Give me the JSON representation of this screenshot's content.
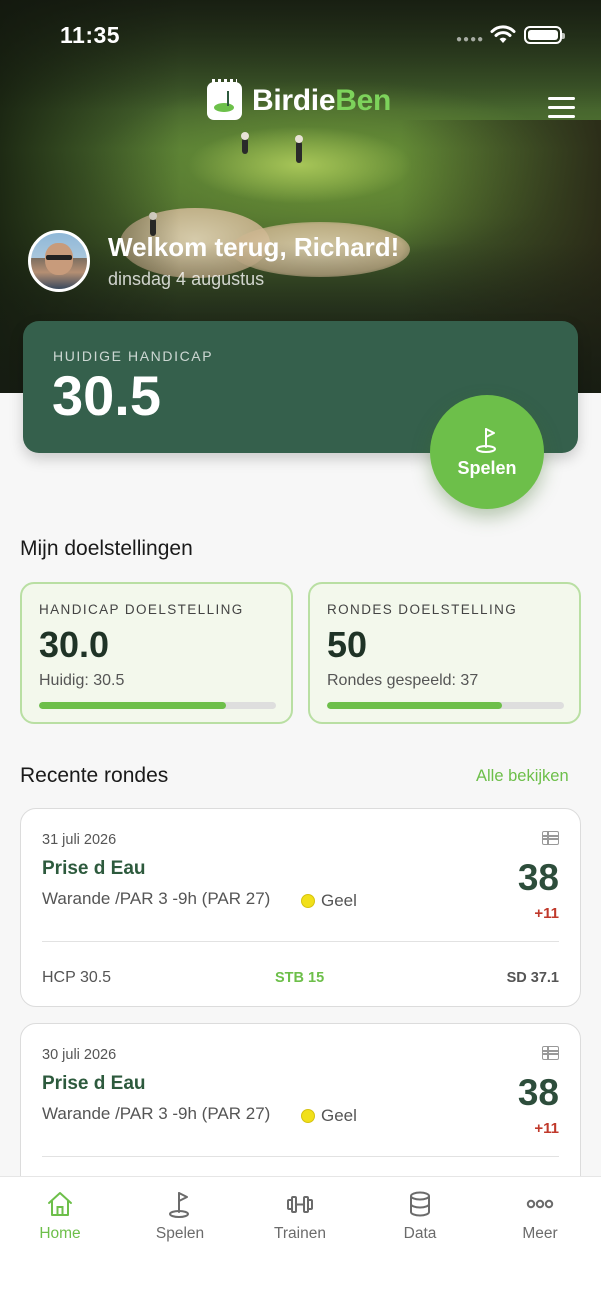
{
  "status_bar": {
    "time": "11:35"
  },
  "header": {
    "brand_part1": "Birdie",
    "brand_part2": "Ben",
    "welcome": "Welkom terug, Richard!",
    "date": "dinsdag 4 augustus"
  },
  "handicap": {
    "label": "HUIDIGE HANDICAP",
    "value": "30.5",
    "play_label": "Spelen"
  },
  "goals": {
    "title": "Mijn doelstellingen",
    "items": [
      {
        "label": "HANDICAP DOELSTELLING",
        "value": "30.0",
        "sub": "Huidig: 30.5",
        "progress": 0.79
      },
      {
        "label": "RONDES DOELSTELLING",
        "value": "50",
        "sub": "Rondes gespeeld: 37",
        "progress": 0.74
      }
    ]
  },
  "rounds": {
    "title": "Recente rondes",
    "see_all": "Alle bekijken",
    "items": [
      {
        "date": "31 juli 2026",
        "course": "Prise d Eau",
        "loop": "Warande /PAR 3 -9h (PAR 27)",
        "tee": "Geel",
        "tee_color": "#f1e01a",
        "score": "38",
        "diff": "+11",
        "hcp": "HCP 30.5",
        "stb": "STB 15",
        "sd": "SD 37.1"
      },
      {
        "date": "30 juli 2026",
        "course": "Prise d Eau",
        "loop": "Warande /PAR 3 -9h (PAR 27)",
        "tee": "Geel",
        "tee_color": "#f1e01a",
        "score": "38",
        "diff": "+11"
      }
    ]
  },
  "tabbar": {
    "items": [
      {
        "label": "Home",
        "icon": "home-icon",
        "active": true
      },
      {
        "label": "Spelen",
        "icon": "golf-flag-icon",
        "active": false
      },
      {
        "label": "Trainen",
        "icon": "dumbbell-icon",
        "active": false
      },
      {
        "label": "Data",
        "icon": "database-icon",
        "active": false
      },
      {
        "label": "Meer",
        "icon": "more-icon",
        "active": false
      }
    ]
  },
  "colors": {
    "brand_green": "#6dbf4a",
    "card_dark_green": "#35604c",
    "course_green": "#2d5a3d",
    "diff_red": "#c0392b"
  }
}
